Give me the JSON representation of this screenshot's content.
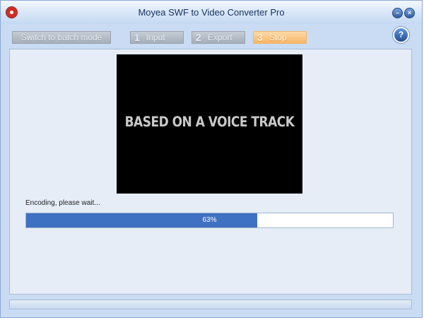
{
  "window": {
    "title": "Moyea SWF to Video Converter Pro"
  },
  "toolbar": {
    "batch_label": "Switch to batch mode",
    "steps": [
      {
        "num": "1",
        "label": "Input"
      },
      {
        "num": "2",
        "label": "Export"
      },
      {
        "num": "3",
        "label": "Stop"
      }
    ],
    "help_label": "?"
  },
  "preview": {
    "text": "BASED ON A VOICE TRACK"
  },
  "encoding": {
    "status": "Encoding, please wait...",
    "progress_percent": 63,
    "progress_label": "63%"
  },
  "colors": {
    "progress_fill": "#3f71c2",
    "stop_accent": "#f7b566"
  },
  "icons": {
    "app": "moyea-logo-icon",
    "minimize": "minimize-icon",
    "close": "close-icon",
    "help": "help-icon"
  }
}
